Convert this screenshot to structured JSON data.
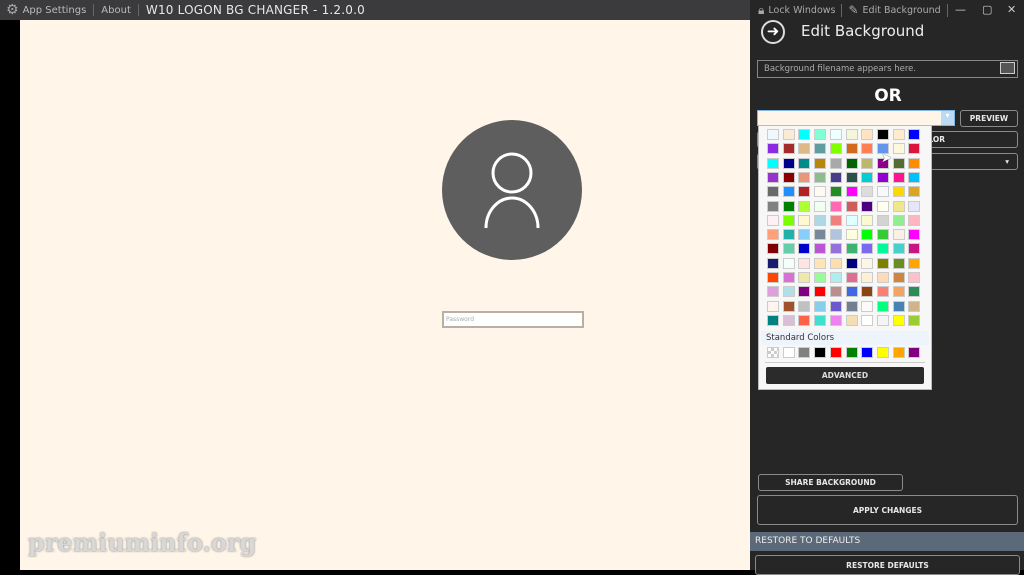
{
  "titlebar": {
    "settings": "App Settings",
    "about": "About",
    "title": "W10 LOGON BG CHANGER - 1.2.0.0"
  },
  "login": {
    "password_placeholder": "Password"
  },
  "watermark": "premiuminfo.org",
  "panel": {
    "lock": "Lock Windows",
    "edit": "Edit Background",
    "heading": "Edit Background",
    "filename_placeholder": "Background filename appears here.",
    "or": "OR",
    "preview": "PREVIEW",
    "hidden_button": "LOR",
    "hidden_dropdown": "e",
    "share": "SHARE BACKGROUND",
    "apply": "APPLY CHANGES",
    "restore_header": "RESTORE TO DEFAULTS",
    "restore": "RESTORE DEFAULTS",
    "selected_color": "#FFF5E8"
  },
  "picker": {
    "standard_label": "Standard Colors",
    "advanced": "ADVANCED",
    "colors": [
      "#F0F8FF",
      "#FAEBD7",
      "#00FFFF",
      "#7FFFD4",
      "#F0FFFF",
      "#F5F5DC",
      "#FFE4C4",
      "#000000",
      "#FFEBCD",
      "#0000FF",
      "#8A2BE2",
      "#A52A2A",
      "#DEB887",
      "#5F9EA0",
      "#7FFF00",
      "#D2691E",
      "#FF7F50",
      "#6495ED",
      "#FFF8DC",
      "#DC143C",
      "#00FFFF",
      "#00008B",
      "#008B8B",
      "#B8860B",
      "#A9A9A9",
      "#006400",
      "#BDB76B",
      "#8B008B",
      "#556B2F",
      "#FF8C00",
      "#9932CC",
      "#8B0000",
      "#E9967A",
      "#8FBC8F",
      "#483D8B",
      "#2F4F4F",
      "#00CED1",
      "#9400D3",
      "#FF1493",
      "#00BFFF",
      "#696969",
      "#1E90FF",
      "#B22222",
      "#FFFAF0",
      "#228B22",
      "#FF00FF",
      "#DCDCDC",
      "#F8F8FF",
      "#FFD700",
      "#DAA520",
      "#808080",
      "#008000",
      "#ADFF2F",
      "#F0FFF0",
      "#FF69B4",
      "#CD5C5C",
      "#4B0082",
      "#FFFFF0",
      "#F0E68C",
      "#E6E6FA",
      "#FFF0F5",
      "#7CFC00",
      "#FFFACD",
      "#ADD8E6",
      "#F08080",
      "#E0FFFF",
      "#FAFAD2",
      "#D3D3D3",
      "#90EE90",
      "#FFB6C1",
      "#FFA07A",
      "#20B2AA",
      "#87CEFA",
      "#778899",
      "#B0C4DE",
      "#FFFFE0",
      "#00FF00",
      "#32CD32",
      "#FAF0E6",
      "#FF00FF",
      "#800000",
      "#66CDAA",
      "#0000CD",
      "#BA55D3",
      "#9370DB",
      "#3CB371",
      "#7B68EE",
      "#00FA9A",
      "#48D1CC",
      "#C71585",
      "#191970",
      "#F5FFFA",
      "#FFE4E1",
      "#FFE4B5",
      "#FFDEAD",
      "#000080",
      "#FDF5E6",
      "#808000",
      "#6B8E23",
      "#FFA500",
      "#FF4500",
      "#DA70D6",
      "#EEE8AA",
      "#98FB98",
      "#AFEEEE",
      "#DB7093",
      "#FFEFD5",
      "#FFDAB9",
      "#CD853F",
      "#FFC0CB",
      "#DDA0DD",
      "#B0E0E6",
      "#800080",
      "#FF0000",
      "#BC8F8F",
      "#4169E1",
      "#8B4513",
      "#FA8072",
      "#F4A460",
      "#2E8B57",
      "#FFF5EE",
      "#A0522D",
      "#C0C0C0",
      "#87CEEB",
      "#6A5ACD",
      "#708090",
      "#FFFAFA",
      "#00FF7F",
      "#4682B4",
      "#D2B48C",
      "#008080",
      "#D8BFD8",
      "#FF6347",
      "#40E0D0",
      "#EE82EE",
      "#F5DEB3",
      "#FFFFFF",
      "#F5F5F5",
      "#FFFF00",
      "#9ACD32"
    ],
    "standard": [
      "transparent",
      "#FFFFFF",
      "#808080",
      "#000000",
      "#FF0000",
      "#008000",
      "#0000FF",
      "#FFFF00",
      "#FFA500",
      "#800080"
    ]
  }
}
